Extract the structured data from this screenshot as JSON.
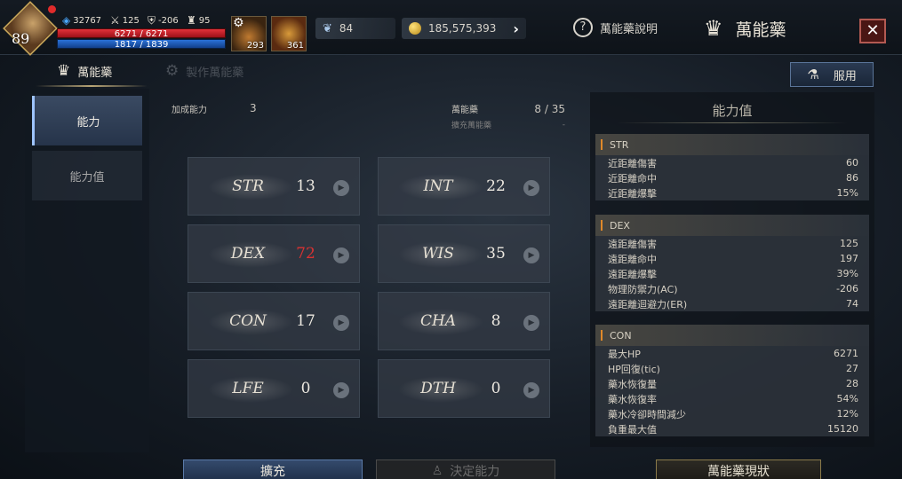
{
  "player": {
    "level": "89",
    "stat1": "32767",
    "stat2": "125",
    "stat3": "-206",
    "stat4": "95",
    "hp": "6271 / 6271",
    "mp": "1817 / 1839"
  },
  "items": [
    {
      "count": "293",
      "icon": "potion-bag-icon"
    },
    {
      "count": "361",
      "icon": "elixir-icon"
    }
  ],
  "currency": {
    "feather": "84",
    "gold": "185,575,393"
  },
  "header": {
    "help_label": "萬能藥說明",
    "title": "萬能藥",
    "close_label": "✕"
  },
  "tabs": [
    {
      "label": "萬能藥",
      "active": true
    },
    {
      "label": "製作萬能藥",
      "active": false
    }
  ],
  "use_button": "服用",
  "sidebar": [
    {
      "label": "能力",
      "active": true
    },
    {
      "label": "能力值",
      "active": false
    }
  ],
  "info": {
    "bonus_label": "加成能力",
    "bonus_value": "3",
    "elixir_label": "萬能藥",
    "elixir_value": "8 / 35",
    "expand_label": "擴充萬能藥",
    "expand_value": "-"
  },
  "stats": [
    {
      "name": "STR",
      "value": "13",
      "highlight": false
    },
    {
      "name": "INT",
      "value": "22",
      "highlight": false
    },
    {
      "name": "DEX",
      "value": "72",
      "highlight": true
    },
    {
      "name": "WIS",
      "value": "35",
      "highlight": false
    },
    {
      "name": "CON",
      "value": "17",
      "highlight": false
    },
    {
      "name": "CHA",
      "value": "8",
      "highlight": false
    },
    {
      "name": "LFE",
      "value": "0",
      "highlight": false
    },
    {
      "name": "DTH",
      "value": "0",
      "highlight": false
    }
  ],
  "right_panel": {
    "title": "能力值",
    "sections": [
      {
        "name": "STR",
        "rows": [
          {
            "label": "近距離傷害",
            "value": "60"
          },
          {
            "label": "近距離命中",
            "value": "86"
          },
          {
            "label": "近距離爆擊",
            "value": "15%"
          }
        ]
      },
      {
        "name": "DEX",
        "rows": [
          {
            "label": "遠距離傷害",
            "value": "125"
          },
          {
            "label": "遠距離命中",
            "value": "197"
          },
          {
            "label": "遠距離爆擊",
            "value": "39%"
          },
          {
            "label": "物理防禦力(AC)",
            "value": "-206"
          },
          {
            "label": "遠距離迴避力(ER)",
            "value": "74"
          }
        ]
      },
      {
        "name": "CON",
        "rows": [
          {
            "label": "最大HP",
            "value": "6271"
          },
          {
            "label": "HP回復(tic)",
            "value": "27"
          },
          {
            "label": "藥水恢復量",
            "value": "28"
          },
          {
            "label": "藥水恢復率",
            "value": "54%"
          },
          {
            "label": "藥水冷卻時間減少",
            "value": "12%"
          },
          {
            "label": "負重最大值",
            "value": "15120"
          }
        ]
      }
    ]
  },
  "bottom_buttons": {
    "expand": "擴充",
    "decide": "決定能力",
    "status": "萬能藥現狀"
  }
}
